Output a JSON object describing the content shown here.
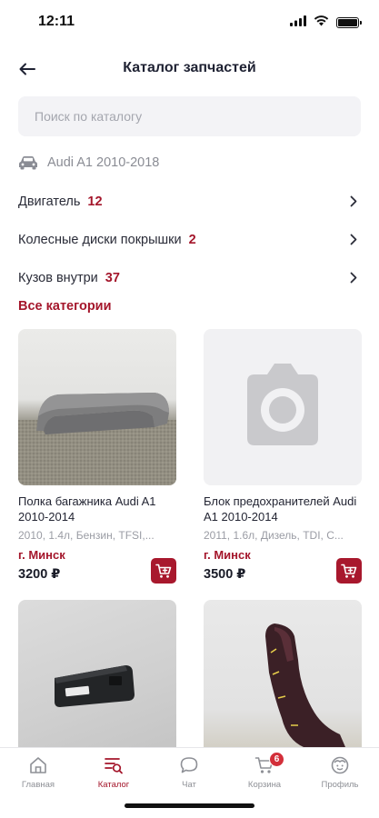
{
  "status_bar": {
    "time": "12:11"
  },
  "header": {
    "title": "Каталог запчастей"
  },
  "search": {
    "placeholder": "Поиск по каталогу"
  },
  "vehicle": {
    "label": "Audi A1 2010-2018"
  },
  "categories": [
    {
      "name": "Двигатель",
      "count": "12"
    },
    {
      "name": "Колесные диски покрышки",
      "count": "2"
    },
    {
      "name": "Кузов внутри",
      "count": "37"
    }
  ],
  "all_categories_label": "Все категории",
  "products": [
    {
      "title": "Полка багажника Audi A1 2010-2014",
      "meta": "2010, 1.4л, Бензин, TFSI,...",
      "city": "г. Минск",
      "price": "3200 ₽"
    },
    {
      "title": "Блок предохранителей Audi A1 2010-2014",
      "meta": "2011, 1.6л, Дизель, TDI, С...",
      "city": "г. Минск",
      "price": "3500 ₽"
    }
  ],
  "tabbar": {
    "items": [
      {
        "label": "Главная",
        "icon": "home-icon"
      },
      {
        "label": "Каталог",
        "icon": "catalog-icon"
      },
      {
        "label": "Чат",
        "icon": "chat-icon"
      },
      {
        "label": "Корзина",
        "icon": "cart-icon",
        "badge": "6"
      },
      {
        "label": "Профиль",
        "icon": "profile-icon"
      }
    ],
    "active": "Каталог"
  },
  "colors": {
    "accent": "#a4162b",
    "badge": "#d32f3a",
    "muted": "#9a9ca4"
  }
}
